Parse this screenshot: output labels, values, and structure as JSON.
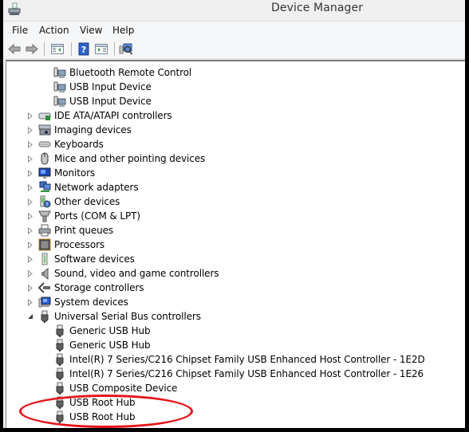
{
  "window": {
    "title": "Device Manager"
  },
  "menu": {
    "items": [
      "File",
      "Action",
      "View",
      "Help"
    ]
  },
  "toolbar": {
    "buttons": [
      "back-icon",
      "forward-icon",
      "show-hide-console-tree-icon",
      "help-icon",
      "show-hide-action-pane-icon",
      "scan-hardware-changes-icon"
    ]
  },
  "tree": {
    "hid_children": [
      {
        "label": "Bluetooth Remote Control",
        "icon": "hid-device-icon"
      },
      {
        "label": "USB Input Device",
        "icon": "hid-device-icon"
      },
      {
        "label": "USB Input Device",
        "icon": "hid-device-icon"
      }
    ],
    "categories": [
      {
        "label": "IDE ATA/ATAPI controllers",
        "icon": "ide-controller-icon",
        "expanded": false
      },
      {
        "label": "Imaging devices",
        "icon": "camera-icon",
        "expanded": false
      },
      {
        "label": "Keyboards",
        "icon": "keyboard-icon",
        "expanded": false
      },
      {
        "label": "Mice and other pointing devices",
        "icon": "mouse-icon",
        "expanded": false
      },
      {
        "label": "Monitors",
        "icon": "monitor-icon",
        "expanded": false
      },
      {
        "label": "Network adapters",
        "icon": "network-adapter-icon",
        "expanded": false
      },
      {
        "label": "Other devices",
        "icon": "unknown-device-icon",
        "expanded": false
      },
      {
        "label": "Ports (COM & LPT)",
        "icon": "port-icon",
        "expanded": false
      },
      {
        "label": "Print queues",
        "icon": "printer-icon",
        "expanded": false
      },
      {
        "label": "Processors",
        "icon": "processor-icon",
        "expanded": false
      },
      {
        "label": "Software devices",
        "icon": "software-device-icon",
        "expanded": false
      },
      {
        "label": "Sound, video and game controllers",
        "icon": "speaker-icon",
        "expanded": false
      },
      {
        "label": "Storage controllers",
        "icon": "storage-controller-icon",
        "expanded": false
      },
      {
        "label": "System devices",
        "icon": "system-device-icon",
        "expanded": false
      },
      {
        "label": "Universal Serial Bus controllers",
        "icon": "usb-icon",
        "expanded": true
      }
    ],
    "usb_children": [
      {
        "label": "Generic USB Hub",
        "icon": "usb-icon"
      },
      {
        "label": "Generic USB Hub",
        "icon": "usb-icon"
      },
      {
        "label": "Intel(R) 7 Series/C216 Chipset Family USB Enhanced Host Controller - 1E2D",
        "icon": "usb-icon"
      },
      {
        "label": "Intel(R) 7 Series/C216 Chipset Family USB Enhanced Host Controller - 1E26",
        "icon": "usb-icon"
      },
      {
        "label": "USB Composite Device",
        "icon": "usb-icon"
      },
      {
        "label": "USB Root Hub",
        "icon": "usb-icon"
      },
      {
        "label": "USB Root Hub",
        "icon": "usb-icon"
      }
    ]
  },
  "annotation": {
    "target": "USB Root Hub entries",
    "color": "#e4161c"
  }
}
